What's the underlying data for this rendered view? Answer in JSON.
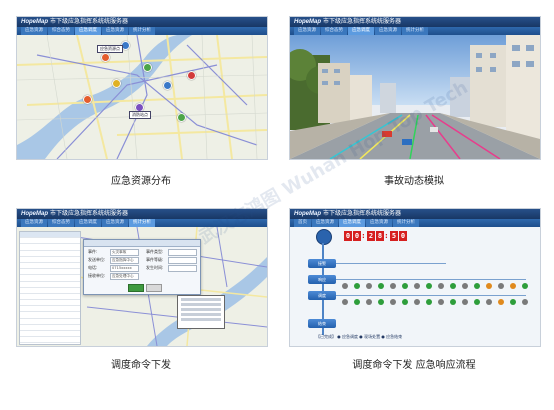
{
  "app": {
    "brand": "HopeMap",
    "title": "市下级应急指挥系统统服务器"
  },
  "captions": [
    "应急资源分布",
    "事故动态模拟",
    "调度命令下发",
    "调度命令下发 应急响应流程"
  ],
  "panels": [
    {
      "tabs": [
        "应急资源",
        "综合态势",
        "应急调度",
        "应急资源",
        "统计分析"
      ],
      "active_tab": 2
    },
    {
      "tabs": [
        "应急资源",
        "综合态势",
        "应急调度",
        "应急资源",
        "统计分析"
      ],
      "active_tab": 2
    },
    {
      "tabs": [
        "应急资源",
        "综合态势",
        "应急调度",
        "应急资源",
        "统计分析"
      ],
      "active_tab": 4
    },
    {
      "tabs": [
        "首页",
        "应急资源",
        "应急调度",
        "应急资源",
        "统计分析"
      ],
      "active_tab": 2
    }
  ],
  "map": {
    "labels": [
      "应急资源点",
      "消防站点"
    ]
  },
  "dispatch_dialog": {
    "fields": [
      {
        "label": "事件:",
        "value": "火灾事故"
      },
      {
        "label": "发送单位:",
        "value": "应急指挥中心"
      },
      {
        "label": "电话:",
        "value": "0715xxxxx"
      },
      {
        "label": "接收单位:",
        "value": "应急处理中心"
      }
    ],
    "right_fields": [
      "事件类型:",
      "事件等级:",
      "发生时间:"
    ]
  },
  "flow": {
    "timer_digits": [
      "0",
      "0",
      "2",
      "8",
      "5",
      "0"
    ],
    "nodes": [
      "接警",
      "响应",
      "调度",
      "结束"
    ],
    "status_text": "【已完成】 ● 应急调度  ● 现场处置  ● 应急结束"
  },
  "watermark": "武汉志鸿图 Wuhan Hop Top Tech"
}
